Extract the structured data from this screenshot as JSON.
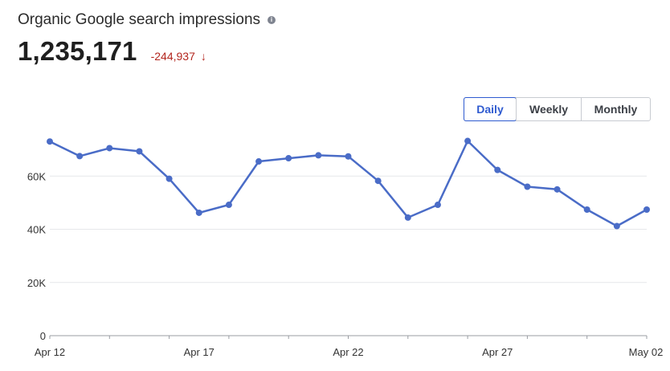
{
  "header": {
    "title": "Organic Google search impressions",
    "info_icon": "info-icon",
    "total": "1,235,171",
    "delta": "-244,937",
    "delta_icon": "arrow-down-icon",
    "delta_color": "#b3261e"
  },
  "period_toggle": {
    "options": [
      "Daily",
      "Weekly",
      "Monthly"
    ],
    "selected": "Daily",
    "accent": "#2f5bd0"
  },
  "chart_data": {
    "type": "line",
    "title": "",
    "xlabel": "",
    "ylabel": "",
    "ylim": [
      0,
      80000
    ],
    "y_ticks": [
      0,
      20000,
      40000,
      60000
    ],
    "y_tick_labels": [
      "0",
      "20K",
      "40K",
      "60K"
    ],
    "x_tick_labels": [
      {
        "date": "Apr 12",
        "label": "Apr 12"
      },
      {
        "date": "Apr 17",
        "label": "Apr 17"
      },
      {
        "date": "Apr 22",
        "label": "Apr 22"
      },
      {
        "date": "Apr 27",
        "label": "Apr 27"
      },
      {
        "date": "May 02",
        "label": "May 02"
      }
    ],
    "grid": true,
    "legend": "none",
    "series": [
      {
        "color": "#4a6cc7",
        "points": [
          {
            "date": "Apr 12",
            "value": 73000
          },
          {
            "date": "Apr 13",
            "value": 67500
          },
          {
            "date": "Apr 14",
            "value": 70500
          },
          {
            "date": "Apr 15",
            "value": 69300
          },
          {
            "date": "Apr 16",
            "value": 59000
          },
          {
            "date": "Apr 17",
            "value": 46200
          },
          {
            "date": "Apr 18",
            "value": 49200
          },
          {
            "date": "Apr 19",
            "value": 65500
          },
          {
            "date": "Apr 20",
            "value": 66700
          },
          {
            "date": "Apr 21",
            "value": 67800
          },
          {
            "date": "Apr 22",
            "value": 67400
          },
          {
            "date": "Apr 23",
            "value": 58200
          },
          {
            "date": "Apr 24",
            "value": 44400
          },
          {
            "date": "Apr 25",
            "value": 49200
          },
          {
            "date": "Apr 26",
            "value": 73200
          },
          {
            "date": "Apr 27",
            "value": 62300
          },
          {
            "date": "Apr 28",
            "value": 56000
          },
          {
            "date": "Apr 29",
            "value": 55000
          },
          {
            "date": "Apr 30",
            "value": 47400
          },
          {
            "date": "May 01",
            "value": 41200
          },
          {
            "date": "May 02",
            "value": 47400
          }
        ]
      }
    ]
  }
}
